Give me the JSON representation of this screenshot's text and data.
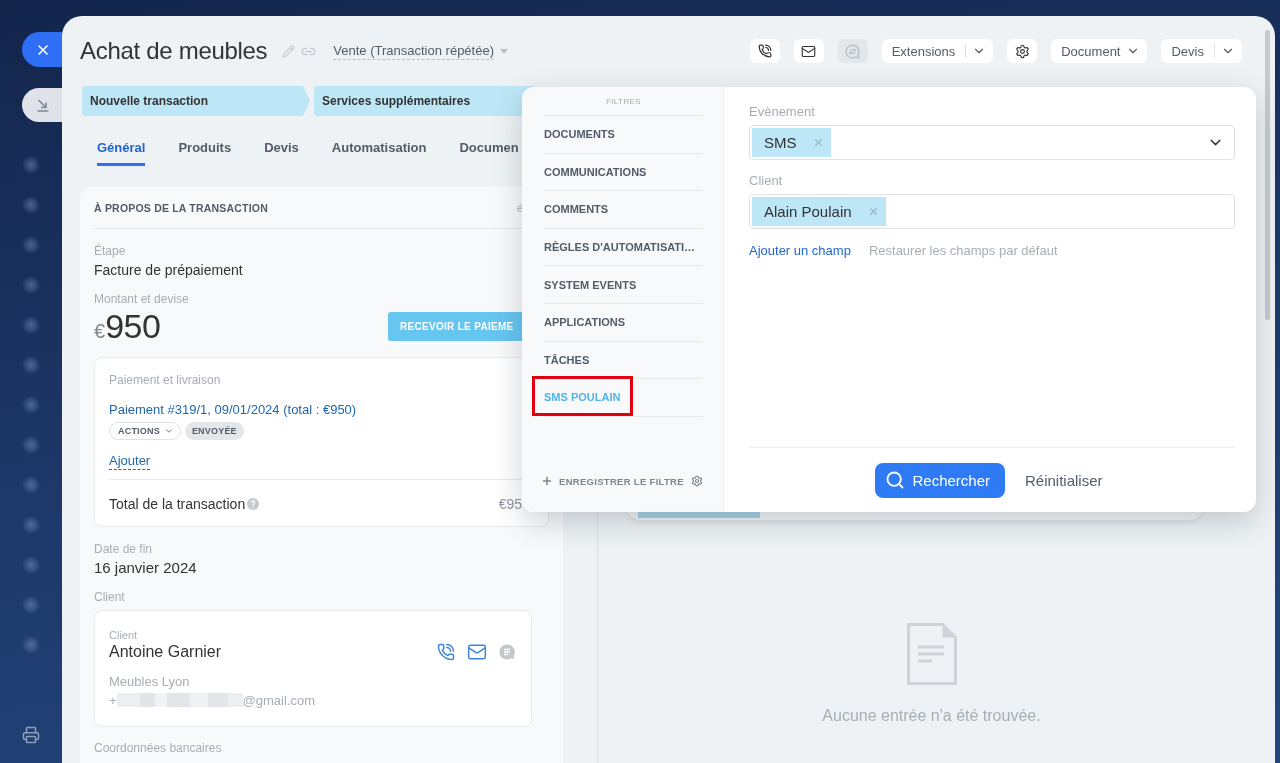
{
  "header": {
    "title": "Achat de meubles",
    "pipeline": "Vente (Transaction répétée)",
    "toolbar": [
      {
        "kind": "phone",
        "disabled": false
      },
      {
        "kind": "mail",
        "disabled": false
      },
      {
        "kind": "chat",
        "disabled": true
      },
      {
        "kind": "split",
        "label": "Extensions",
        "disabled": false
      },
      {
        "kind": "settings",
        "disabled": false
      },
      {
        "kind": "dropdown",
        "label": "Document",
        "disabled": false
      },
      {
        "kind": "split",
        "label": "Devis",
        "disabled": false
      }
    ]
  },
  "stages": [
    {
      "label": "Nouvelle transaction"
    },
    {
      "label": "Services supplémentaires"
    }
  ],
  "tabs": [
    {
      "label": "Général",
      "selected": true
    },
    {
      "label": "Produits",
      "selected": false
    },
    {
      "label": "Devis",
      "selected": false
    },
    {
      "label": "Automatisation",
      "selected": false
    },
    {
      "label": "Documen",
      "selected": false
    }
  ],
  "about_card": {
    "title": "À PROPOS DE LA TRANSACTION",
    "header_link": "é",
    "stage": {
      "label": "Étape",
      "value": "Facture de prépaiement"
    },
    "amount": {
      "label": "Montant et devise",
      "currency": "€",
      "value": "950",
      "button": "RECEVOIR LE PAIEME"
    },
    "payment": {
      "title": "Paiement et livraison",
      "link": "Paiement #319/1, 09/01/2024 (total : €950)",
      "actions_button": "ACTIONS",
      "status_badge": "ENVOYÉE",
      "add_link": "Ajouter",
      "total_label": "Total de la transaction",
      "total_value": "€95"
    },
    "end_date": {
      "label": "Date de fin",
      "value": "16 janvier 2024"
    },
    "client": {
      "label": "Client",
      "card_label": "Client",
      "name": "Antoine Garnier",
      "company": "Meubles Lyon",
      "contact_prefix": "+",
      "contact_suffix": "@gmail.com"
    },
    "bank_details_label": "Coordonnées bancaires"
  },
  "timeline": {
    "empty_message": "Aucune entrée n'a été trouvée."
  },
  "filter_popup": {
    "heading": "FILTRES",
    "presets": [
      {
        "label": "DOCUMENTS",
        "selected": false,
        "highlighted": false
      },
      {
        "label": "COMMUNICATIONS",
        "selected": false,
        "highlighted": false
      },
      {
        "label": "COMMENTS",
        "selected": false,
        "highlighted": false
      },
      {
        "label": "RÈGLES D'AUTOMATISATI…",
        "selected": false,
        "highlighted": false
      },
      {
        "label": "SYSTEM EVENTS",
        "selected": false,
        "highlighted": false
      },
      {
        "label": "APPLICATIONS",
        "selected": false,
        "highlighted": false
      },
      {
        "label": "TÂCHES",
        "selected": false,
        "highlighted": false
      },
      {
        "label": "SMS POULAIN",
        "selected": true,
        "highlighted": true
      }
    ],
    "save_button": "ENREGISTRER LE FILTRE",
    "fields": [
      {
        "label": "Evènement",
        "kind": "select",
        "tags": [
          "SMS"
        ]
      },
      {
        "label": "Client",
        "kind": "entity",
        "tags": [
          "Alain Poulain"
        ]
      }
    ],
    "add_field_link": "Ajouter un champ",
    "restore_link": "Restaurer les champs par défaut",
    "search_button": "Rechercher",
    "reset_button": "Réinitialiser"
  }
}
